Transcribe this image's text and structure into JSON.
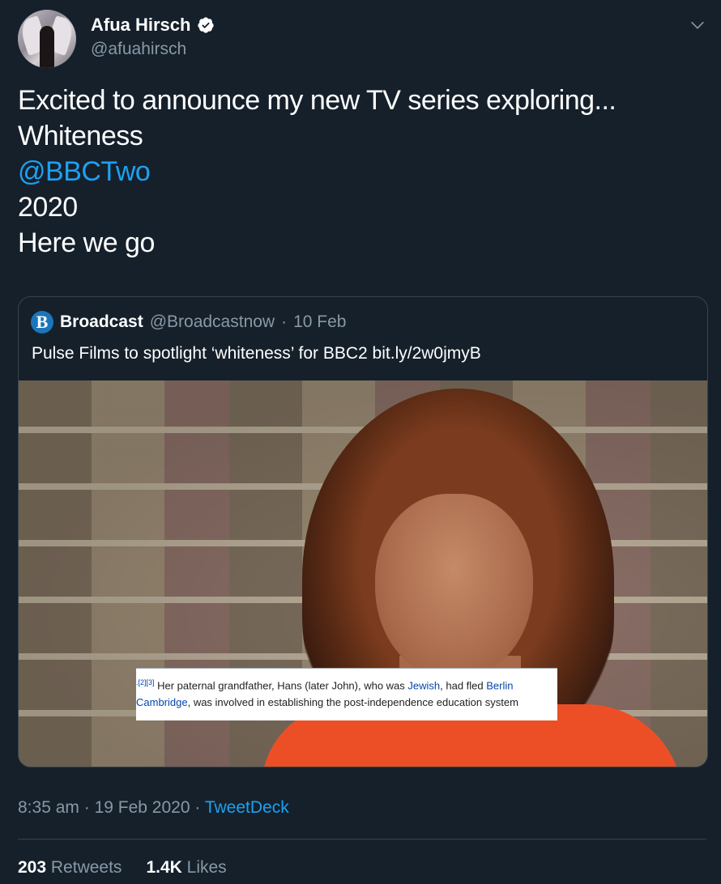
{
  "author": {
    "display_name": "Afua Hirsch",
    "handle": "@afuahirsch"
  },
  "tweet": {
    "lines": [
      "Excited to announce my new TV series exploring...",
      "Whiteness",
      "@BBCTwo",
      "2020",
      "Here we go"
    ]
  },
  "quoted": {
    "logo_letter": "B",
    "name": "Broadcast",
    "handle": "@Broadcastnow",
    "separator": "·",
    "date": "10 Feb",
    "text": "Pulse Films to spotlight ‘whiteness’ for BBC2 bit.ly/2w0jmyB",
    "snippet": {
      "cite": ".[2][3]",
      "line1_a": " Her paternal grandfather, Hans (later John), who was ",
      "line1_link1": "Jewish",
      "line1_b": ", had fled ",
      "line1_link2": "Berlin",
      "line2_link": "Cambridge",
      "line2_rest": ", was involved in establishing the post-independence education system"
    }
  },
  "meta": {
    "time": "8:35 am",
    "separator": "·",
    "date": "19 Feb 2020",
    "source": "TweetDeck"
  },
  "stats": {
    "retweets_count": "203",
    "retweets_label": "Retweets",
    "likes_count": "1.4K",
    "likes_label": "Likes"
  },
  "colors": {
    "background": "#15202b",
    "accent": "#1da1f2",
    "secondary_text": "#8899a6"
  },
  "icons": {
    "verified": "verified-badge-icon",
    "menu": "chevron-down-icon"
  }
}
